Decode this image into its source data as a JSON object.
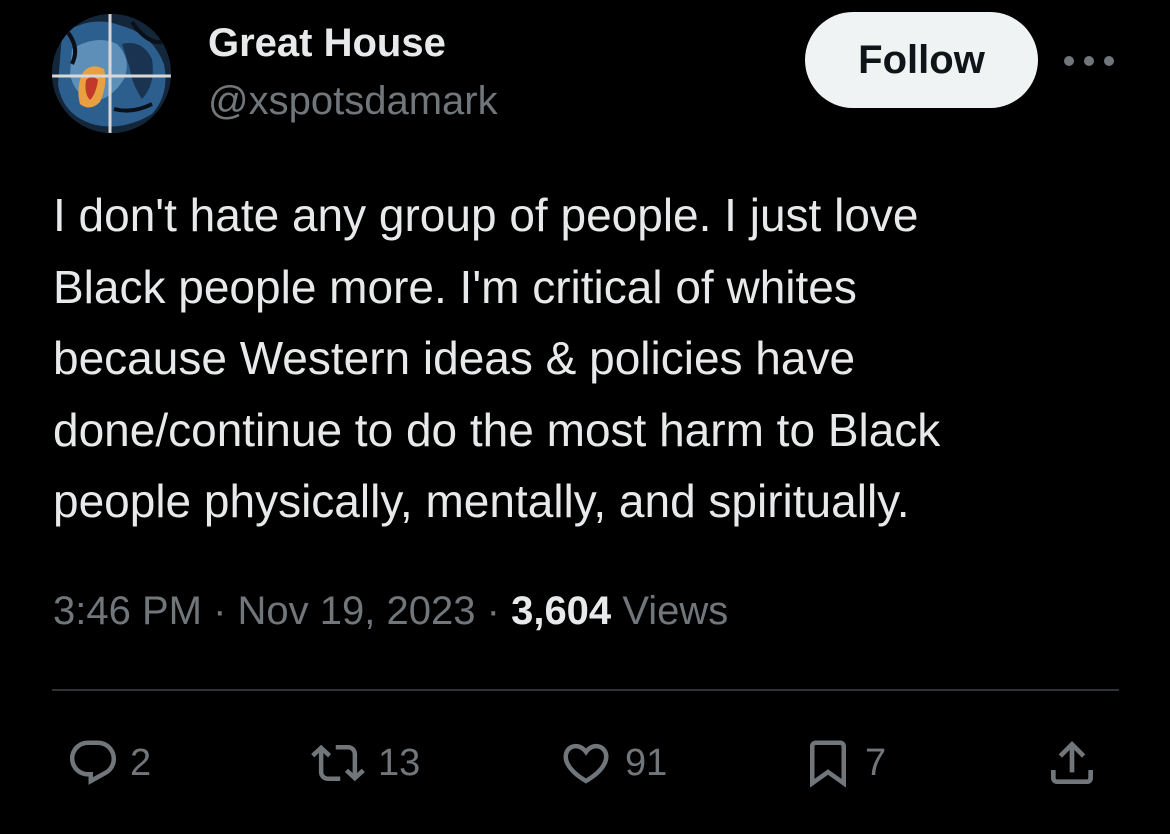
{
  "author": {
    "display_name": "Great House",
    "handle": "@xspotsdamark",
    "avatar_icon": "panther-avatar"
  },
  "header": {
    "follow_label": "Follow",
    "more_icon": "more-dots-icon"
  },
  "tweet": {
    "lines": [
      "I don't hate any group of people. I just love",
      "Black people more. I'm critical of whites",
      "because Western ideas & policies have",
      "done/continue to do the most harm to Black",
      "people physically, mentally, and spiritually."
    ],
    "time": "3:46 PM",
    "separator": "·",
    "date": "Nov 19, 2023",
    "views_count": "3,604",
    "views_label": "Views"
  },
  "actions": {
    "replies": {
      "icon": "reply-icon",
      "count": "2"
    },
    "retweets": {
      "icon": "retweet-icon",
      "count": "13"
    },
    "likes": {
      "icon": "heart-icon",
      "count": "91"
    },
    "bookmarks": {
      "icon": "bookmark-icon",
      "count": "7"
    },
    "share": {
      "icon": "share-icon"
    }
  },
  "colors": {
    "background": "#000000",
    "text_primary": "#e7e9ea",
    "text_secondary": "#71767b",
    "divider": "#2f3336",
    "follow_bg": "#eff3f4"
  }
}
